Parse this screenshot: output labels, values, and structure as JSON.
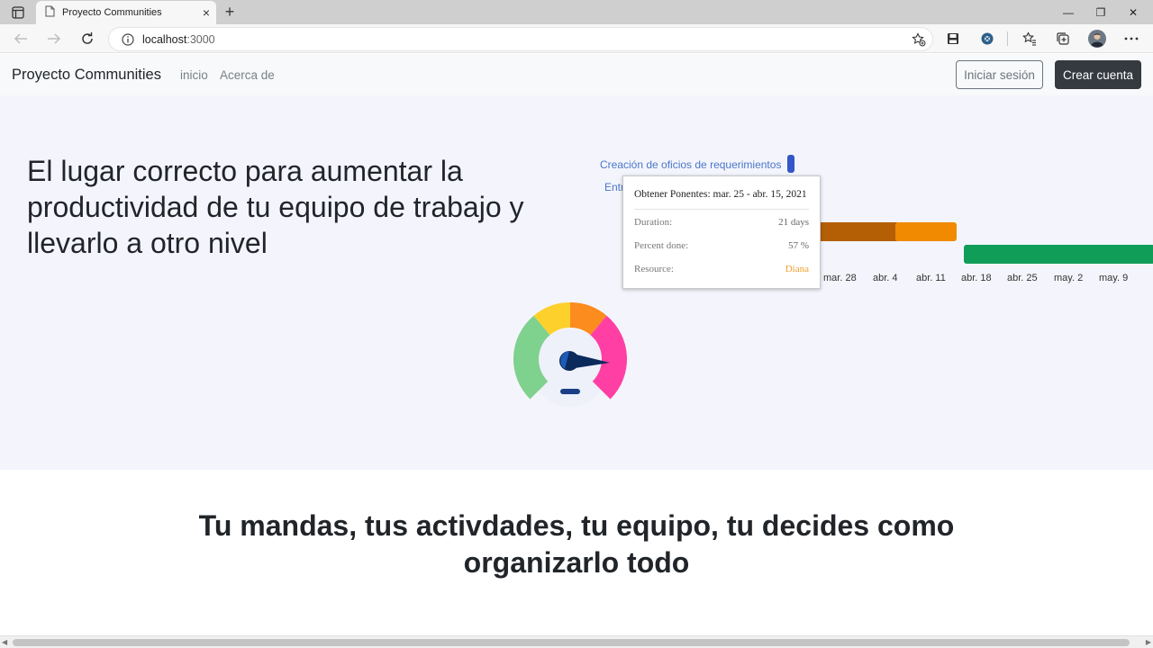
{
  "browser": {
    "tab_title": "Proyecto Communities",
    "tab_close": "×",
    "new_tab": "+",
    "url_host": "localhost",
    "url_port": ":3000",
    "window_controls": {
      "minimize": "—",
      "maximize": "❐",
      "close": "✕"
    }
  },
  "navbar": {
    "brand": "Proyecto Communities",
    "links": [
      "inicio",
      "Acerca de"
    ],
    "login_button": "Iniciar sesión",
    "signup_button": "Crear cuenta"
  },
  "hero": {
    "title": "El lugar correcto para aumentar la productividad de tu equipo de trabajo y llevarlo a otro nivel"
  },
  "gantt": {
    "task_labels": [
      "Creación de oficios de requerimientos",
      "Entr"
    ],
    "ticks": [
      "mar. 28",
      "abr. 4",
      "abr. 11",
      "abr. 18",
      "abr. 25",
      "may. 2",
      "may. 9"
    ],
    "colors": {
      "task1": "#3357c8",
      "task2_done": "#b45f06",
      "task2_rest": "#f18a00",
      "task3": "#0f9d58"
    }
  },
  "tooltip": {
    "header": "Obtener Ponentes: mar. 25 - abr. 15, 2021",
    "rows": [
      {
        "label": "Duration:",
        "value": "21 days"
      },
      {
        "label": "Percent done:",
        "value": "57 %"
      },
      {
        "label": "Resource:",
        "value": "Diana"
      }
    ]
  },
  "section2": {
    "title": "Tu mandas, tus activdades, tu equipo, tu decides como organizarlo todo"
  },
  "colors": {
    "hero_bg": "#f4f5fc",
    "navbar_bg": "#f8f9fa",
    "dark_button": "#343a40"
  }
}
